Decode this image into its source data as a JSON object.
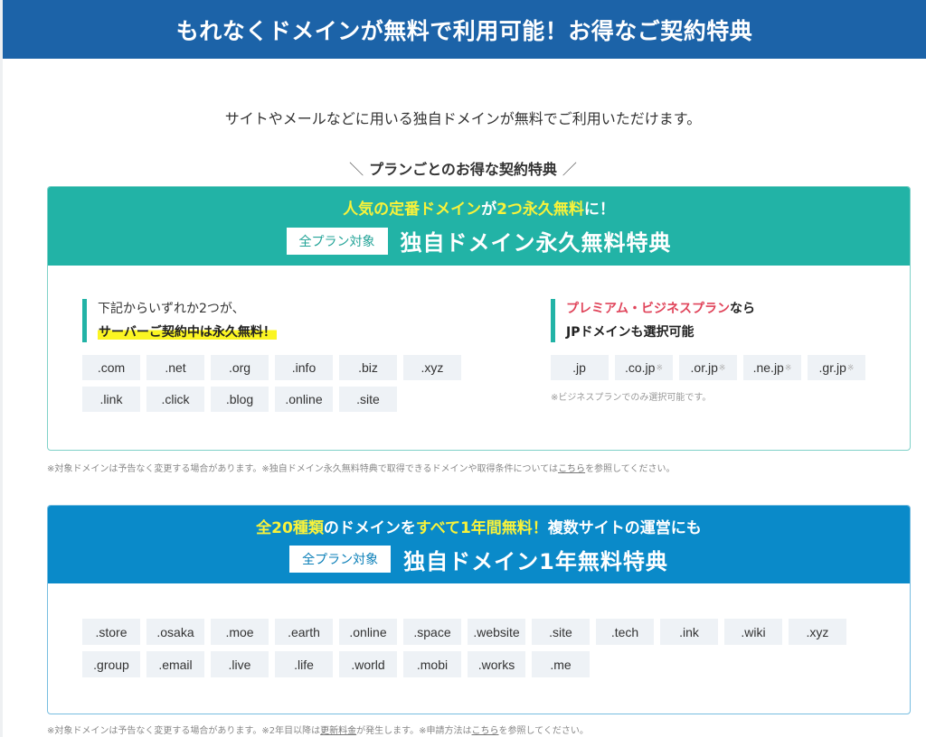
{
  "banner": {
    "title": "もれなくドメインが無料で利用可能！お得なご契約特典"
  },
  "intro": "サイトやメールなどに用いる独自ドメインが無料でご利用いただけます。",
  "subhead": {
    "slash_left": "＼",
    "text": "プランごとのお得な契約特典",
    "slash_right": "／"
  },
  "colors": {
    "banner": "#1c63a8",
    "card1_header": "#22b3a6",
    "card2_header": "#0a8ac9",
    "highlight_yellow": "#f8f23a",
    "accent_red": "#e0445a",
    "chip_bg": "#eef2f6"
  },
  "card1": {
    "headline": {
      "part1": "人気の定番ドメイン",
      "part2": "が",
      "part3": "2つ永久無料",
      "part4": "に！"
    },
    "badge": "全プラン対象",
    "title": "独自ドメイン永久無料特典",
    "left": {
      "line1": "下記からいずれか2つが、",
      "line2": "サーバーご契約中は永久無料！",
      "domains": [
        ".com",
        ".net",
        ".org",
        ".info",
        ".biz",
        ".xyz",
        ".link",
        ".click",
        ".blog",
        ".online",
        ".site"
      ]
    },
    "right": {
      "line1_red": "プレミアム・ビジネスプラン",
      "line1_rest": "なら",
      "line2": "JPドメインも選択可能",
      "domains": [
        {
          "name": ".jp",
          "mark": ""
        },
        {
          "name": ".co.jp",
          "mark": "※"
        },
        {
          "name": ".or.jp",
          "mark": "※"
        },
        {
          "name": ".ne.jp",
          "mark": "※"
        },
        {
          "name": ".gr.jp",
          "mark": "※"
        }
      ],
      "note": "※ビジネスプランでのみ選択可能です。"
    },
    "footnote": {
      "text1": "※対象ドメインは予告なく変更する場合があります。※独自ドメイン永久無料特典で取得できるドメインや取得条件については",
      "link": "こちら",
      "text2": "を参照してください。"
    }
  },
  "card2": {
    "headline": {
      "part1": "全20種類",
      "part2": "のドメインを",
      "part3": "すべて1年間無料！",
      "part4": "複数サイトの運営にも"
    },
    "badge": "全プラン対象",
    "title": "独自ドメイン1年無料特典",
    "domains": [
      ".store",
      ".osaka",
      ".moe",
      ".earth",
      ".online",
      ".space",
      ".website",
      ".site",
      ".tech",
      ".ink",
      ".wiki",
      ".xyz",
      ".group",
      ".email",
      ".live",
      ".life",
      ".world",
      ".mobi",
      ".works",
      ".me"
    ],
    "footnote": {
      "text1": "※対象ドメインは予告なく変更する場合があります。※2年目以降は",
      "link1": "更新料金",
      "text2": "が発生します。※申請方法は",
      "link2": "こちら",
      "text3": "を参照してください。"
    }
  }
}
